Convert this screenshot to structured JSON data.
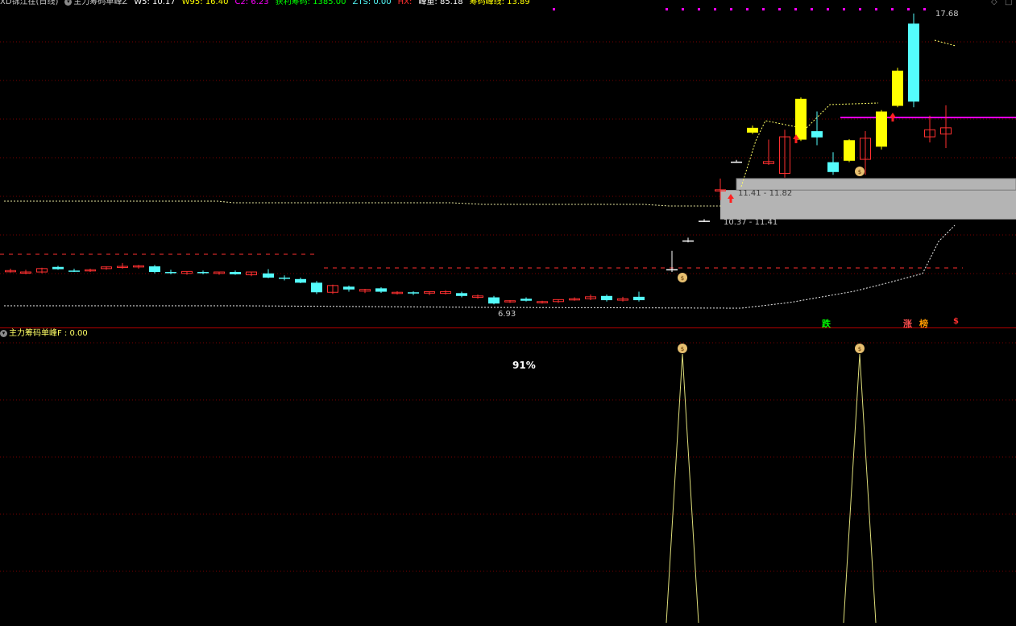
{
  "main_header": {
    "title": "XD锦江在(日线)",
    "indicator": "主力筹码单峰Z",
    "w5": "W5: 10.17",
    "w95": "W95: 16.40",
    "c2": "C2: 6.23",
    "profit": "获利筹码: 1385.00",
    "zts": "ZTS: 0.00",
    "hx": "HX:",
    "peak_volume": "峰重: 85.18",
    "peak_line": "筹码峰线: 13.89"
  },
  "sub_header": {
    "indicator": "主力筹码单峰F : 0.00"
  },
  "price_labels": {
    "high": "17.68",
    "low": "6.93",
    "band_upper": "11.41 - 11.82",
    "band_lower": "10.37 - 11.41"
  },
  "signals": {
    "die": "跌",
    "zhang": "涨",
    "bang": "榜",
    "s": "$"
  },
  "sub_percent": "91%",
  "colors": {
    "up": "#ff3030",
    "down": "#54fcfc",
    "yellow_candle": "#ffff00",
    "band": "#b4b4b4",
    "magenta": "#ff00ff",
    "grid": "#7a0000"
  },
  "chart_data": {
    "type": "candlestick",
    "y_axis": "price",
    "candles": [
      {
        "o": 8.55,
        "h": 8.62,
        "l": 8.48,
        "c": 8.55,
        "kind": "up"
      },
      {
        "o": 8.5,
        "h": 8.58,
        "l": 8.42,
        "c": 8.5,
        "kind": "up"
      },
      {
        "o": 8.5,
        "h": 8.65,
        "l": 8.45,
        "c": 8.62,
        "kind": "up"
      },
      {
        "o": 8.68,
        "h": 8.72,
        "l": 8.58,
        "c": 8.6,
        "kind": "down"
      },
      {
        "o": 8.55,
        "h": 8.62,
        "l": 8.5,
        "c": 8.55,
        "kind": "down"
      },
      {
        "o": 8.55,
        "h": 8.62,
        "l": 8.5,
        "c": 8.58,
        "kind": "up"
      },
      {
        "o": 8.62,
        "h": 8.7,
        "l": 8.58,
        "c": 8.68,
        "kind": "up"
      },
      {
        "o": 8.68,
        "h": 8.82,
        "l": 8.62,
        "c": 8.7,
        "kind": "up"
      },
      {
        "o": 8.68,
        "h": 8.75,
        "l": 8.62,
        "c": 8.72,
        "kind": "up"
      },
      {
        "o": 8.7,
        "h": 8.75,
        "l": 8.45,
        "c": 8.5,
        "kind": "down"
      },
      {
        "o": 8.5,
        "h": 8.58,
        "l": 8.42,
        "c": 8.5,
        "kind": "down"
      },
      {
        "o": 8.45,
        "h": 8.52,
        "l": 8.4,
        "c": 8.52,
        "kind": "up"
      },
      {
        "o": 8.5,
        "h": 8.55,
        "l": 8.42,
        "c": 8.5,
        "kind": "down"
      },
      {
        "o": 8.45,
        "h": 8.5,
        "l": 8.4,
        "c": 8.5,
        "kind": "up"
      },
      {
        "o": 8.5,
        "h": 8.55,
        "l": 8.4,
        "c": 8.42,
        "kind": "down"
      },
      {
        "o": 8.4,
        "h": 8.5,
        "l": 8.35,
        "c": 8.5,
        "kind": "up"
      },
      {
        "o": 8.45,
        "h": 8.6,
        "l": 8.28,
        "c": 8.3,
        "kind": "down"
      },
      {
        "o": 8.3,
        "h": 8.38,
        "l": 8.2,
        "c": 8.28,
        "kind": "down"
      },
      {
        "o": 8.25,
        "h": 8.3,
        "l": 8.1,
        "c": 8.12,
        "kind": "down"
      },
      {
        "o": 8.12,
        "h": 8.18,
        "l": 7.72,
        "c": 7.78,
        "kind": "down"
      },
      {
        "o": 7.78,
        "h": 8.05,
        "l": 7.72,
        "c": 8.02,
        "kind": "up"
      },
      {
        "o": 7.98,
        "h": 8.02,
        "l": 7.8,
        "c": 7.88,
        "kind": "down"
      },
      {
        "o": 7.82,
        "h": 7.9,
        "l": 7.75,
        "c": 7.88,
        "kind": "up"
      },
      {
        "o": 7.92,
        "h": 7.96,
        "l": 7.76,
        "c": 7.8,
        "kind": "down"
      },
      {
        "o": 7.78,
        "h": 7.82,
        "l": 7.7,
        "c": 7.75,
        "kind": "up"
      },
      {
        "o": 7.74,
        "h": 7.82,
        "l": 7.68,
        "c": 7.78,
        "kind": "down"
      },
      {
        "o": 7.75,
        "h": 7.8,
        "l": 7.68,
        "c": 7.8,
        "kind": "up"
      },
      {
        "o": 7.74,
        "h": 7.85,
        "l": 7.7,
        "c": 7.8,
        "kind": "up"
      },
      {
        "o": 7.75,
        "h": 7.8,
        "l": 7.6,
        "c": 7.65,
        "kind": "down"
      },
      {
        "o": 7.65,
        "h": 7.7,
        "l": 7.55,
        "c": 7.6,
        "kind": "up"
      },
      {
        "o": 7.6,
        "h": 7.65,
        "l": 7.35,
        "c": 7.38,
        "kind": "down"
      },
      {
        "o": 7.45,
        "h": 7.5,
        "l": 7.4,
        "c": 7.48,
        "kind": "up"
      },
      {
        "o": 7.55,
        "h": 7.6,
        "l": 7.45,
        "c": 7.48,
        "kind": "down"
      },
      {
        "o": 7.42,
        "h": 7.48,
        "l": 7.38,
        "c": 7.45,
        "kind": "up"
      },
      {
        "o": 7.45,
        "h": 7.52,
        "l": 7.4,
        "c": 7.52,
        "kind": "up"
      },
      {
        "o": 7.52,
        "h": 7.6,
        "l": 7.48,
        "c": 7.55,
        "kind": "up"
      },
      {
        "o": 7.55,
        "h": 7.7,
        "l": 7.5,
        "c": 7.62,
        "kind": "up"
      },
      {
        "o": 7.65,
        "h": 7.7,
        "l": 7.45,
        "c": 7.5,
        "kind": "down"
      },
      {
        "o": 7.5,
        "h": 7.62,
        "l": 7.45,
        "c": 7.55,
        "kind": "up"
      },
      {
        "o": 7.62,
        "h": 7.8,
        "l": 7.45,
        "c": 7.5,
        "kind": "down"
      },
      {
        "o": 8.58,
        "h": 9.25,
        "l": 8.5,
        "c": 8.6,
        "kind": "flat"
      },
      {
        "o": 9.6,
        "h": 9.72,
        "l": 9.55,
        "c": 9.62,
        "kind": "flat"
      },
      {
        "o": 10.32,
        "h": 10.38,
        "l": 10.28,
        "c": 10.32,
        "kind": "flat"
      },
      {
        "o": 11.38,
        "h": 11.82,
        "l": 11.05,
        "c": 11.42,
        "kind": "up"
      },
      {
        "o": 12.42,
        "h": 12.48,
        "l": 12.38,
        "c": 12.42,
        "kind": "flat"
      },
      {
        "o": 13.45,
        "h": 13.7,
        "l": 13.4,
        "c": 13.62,
        "kind": "yellow"
      },
      {
        "o": 12.35,
        "h": 13.2,
        "l": 12.3,
        "c": 12.42,
        "kind": "up"
      },
      {
        "o": 12.0,
        "h": 13.55,
        "l": 11.85,
        "c": 13.3,
        "kind": "up"
      },
      {
        "o": 13.2,
        "h": 14.7,
        "l": 13.15,
        "c": 14.65,
        "kind": "yellow"
      },
      {
        "o": 13.5,
        "h": 14.2,
        "l": 13.0,
        "c": 13.28,
        "kind": "down"
      },
      {
        "o": 12.4,
        "h": 12.75,
        "l": 11.95,
        "c": 12.05,
        "kind": "down"
      },
      {
        "o": 12.45,
        "h": 13.22,
        "l": 12.4,
        "c": 13.18,
        "kind": "yellow"
      },
      {
        "o": 12.5,
        "h": 13.5,
        "l": 11.95,
        "c": 13.25,
        "kind": "up"
      },
      {
        "o": 12.95,
        "h": 14.25,
        "l": 12.85,
        "c": 14.2,
        "kind": "yellow"
      },
      {
        "o": 14.4,
        "h": 15.75,
        "l": 14.35,
        "c": 15.65,
        "kind": "yellow"
      },
      {
        "o": 17.32,
        "h": 17.68,
        "l": 14.35,
        "c": 14.55,
        "kind": "down"
      },
      {
        "o": 13.3,
        "h": 14.05,
        "l": 13.1,
        "c": 13.55,
        "kind": "up"
      },
      {
        "o": 13.4,
        "h": 14.42,
        "l": 12.9,
        "c": 13.62,
        "kind": "up"
      }
    ],
    "chip_bands": [
      {
        "low": 10.37,
        "high": 11.41
      },
      {
        "low": 11.41,
        "high": 11.82
      }
    ]
  }
}
